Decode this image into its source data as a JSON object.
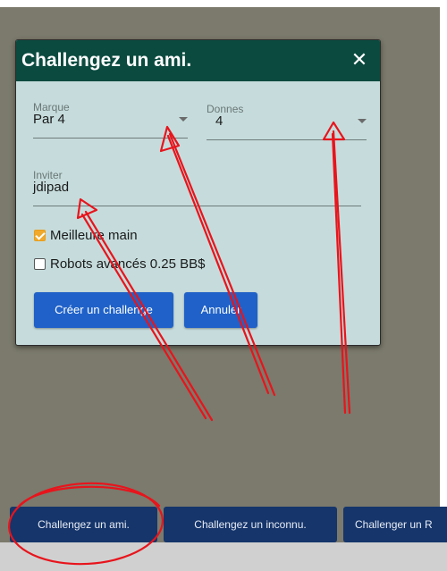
{
  "dialog": {
    "title": "Challengez un ami.",
    "close_glyph": "✕",
    "marque": {
      "label": "Marque",
      "value": "Par 4"
    },
    "donnes": {
      "label": "Donnes",
      "value": "4"
    },
    "inviter": {
      "label": "Inviter",
      "value": "jdipad"
    },
    "options": [
      {
        "label": "Meilleure main",
        "checked": true
      },
      {
        "label": "Robots avancés 0.25 BB$",
        "checked": false
      }
    ],
    "buttons": {
      "create": "Créer un challenge",
      "cancel": "Annuler"
    }
  },
  "bottom_bar": {
    "buttons": [
      "Challengez un ami.",
      "Challengez un inconnu.",
      "Challenger un R"
    ]
  },
  "colors": {
    "backdrop": "#7b7a6c",
    "dialog_header": "#0a4a3f",
    "dialog_body": "#c6dcdc",
    "primary_button": "#1f61c8",
    "bar_button": "#15356b",
    "checkbox_checked": "#f0a92c",
    "annotation": "#e8141c"
  }
}
